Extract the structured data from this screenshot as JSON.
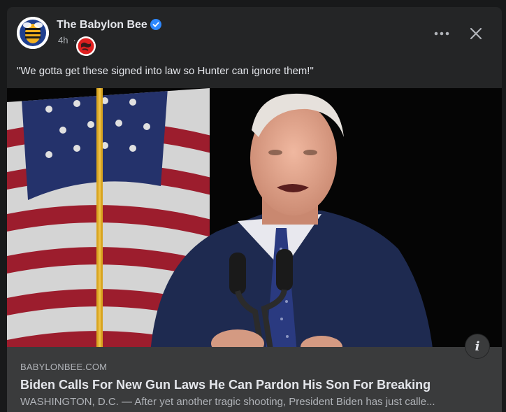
{
  "post": {
    "page_name": "The Babylon Bee",
    "time": "4h",
    "separator": "·",
    "caption": "\"We gotta get these signed into law so Hunter can ignore them!\""
  },
  "link": {
    "domain": "BABYLONBEE.COM",
    "headline": "Biden Calls For New Gun Laws He Can Pardon His Son For Breaking",
    "description": "WASHINGTON, D.C. — After yet another tragic shooting, President Biden has just calle..."
  },
  "icons": {
    "avatar": "babylon-bee-logo",
    "verified": "verified-badge-icon",
    "audience": "globe-red-icon",
    "more": "more-dots-icon",
    "close": "close-icon",
    "info": "info-icon"
  },
  "colors": {
    "background": "#18191a",
    "card": "#242526",
    "footer": "#3a3b3c",
    "verified": "#2d88ff",
    "audience_badge": "#e02020"
  }
}
